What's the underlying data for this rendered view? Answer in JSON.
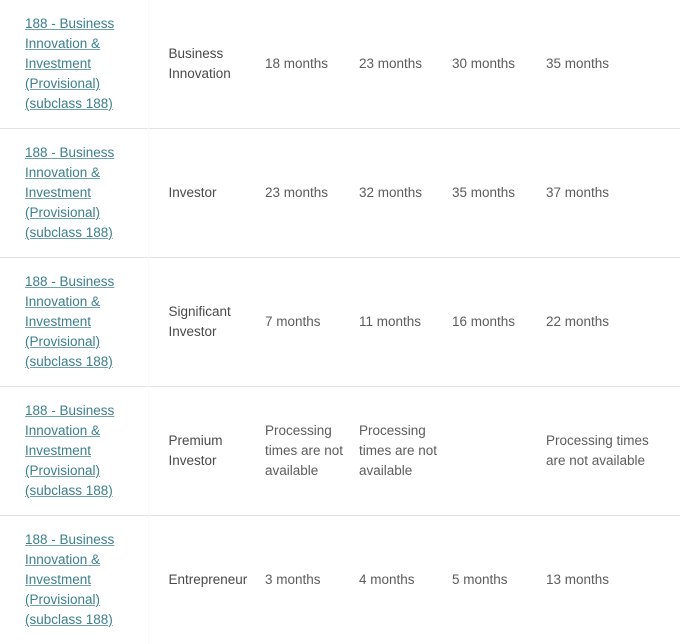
{
  "table": {
    "name": "visa-processing-times",
    "unavailable_text": "Processing times are not available",
    "rows": [
      {
        "visa": "188 - Business Innovation & Investment (Provisional) (subclass 188)",
        "stream": "Business Innovation",
        "times": [
          "18 months",
          "23 months",
          "30 months",
          "35 months"
        ]
      },
      {
        "visa": "188 - Business Innovation & Investment (Provisional) (subclass 188)",
        "stream": "Investor",
        "times": [
          "23 months",
          "32 months",
          "35 months",
          "37 months"
        ]
      },
      {
        "visa": "188 - Business Innovation & Investment (Provisional) (subclass 188)",
        "stream": "Significant Investor",
        "times": [
          "7 months",
          "11 months",
          "16 months",
          "22 months"
        ]
      },
      {
        "visa": "188 - Business Innovation & Investment (Provisional) (subclass 188)",
        "stream": "Premium Investor",
        "times": [
          "Processing times are not available",
          "Processing times are not available",
          "",
          "Processing times are not available"
        ]
      },
      {
        "visa": "188 - Business Innovation & Investment (Provisional) (subclass 188)",
        "stream": "Entrepreneur",
        "times": [
          "3 months",
          "4 months",
          "5 months",
          "13 months"
        ]
      }
    ]
  },
  "colors": {
    "link": "#3c7f8d",
    "text": "#4a4a4a",
    "value_text": "#5c5c5c",
    "row_divider": "#e2e2e2",
    "background": "#ffffff"
  }
}
